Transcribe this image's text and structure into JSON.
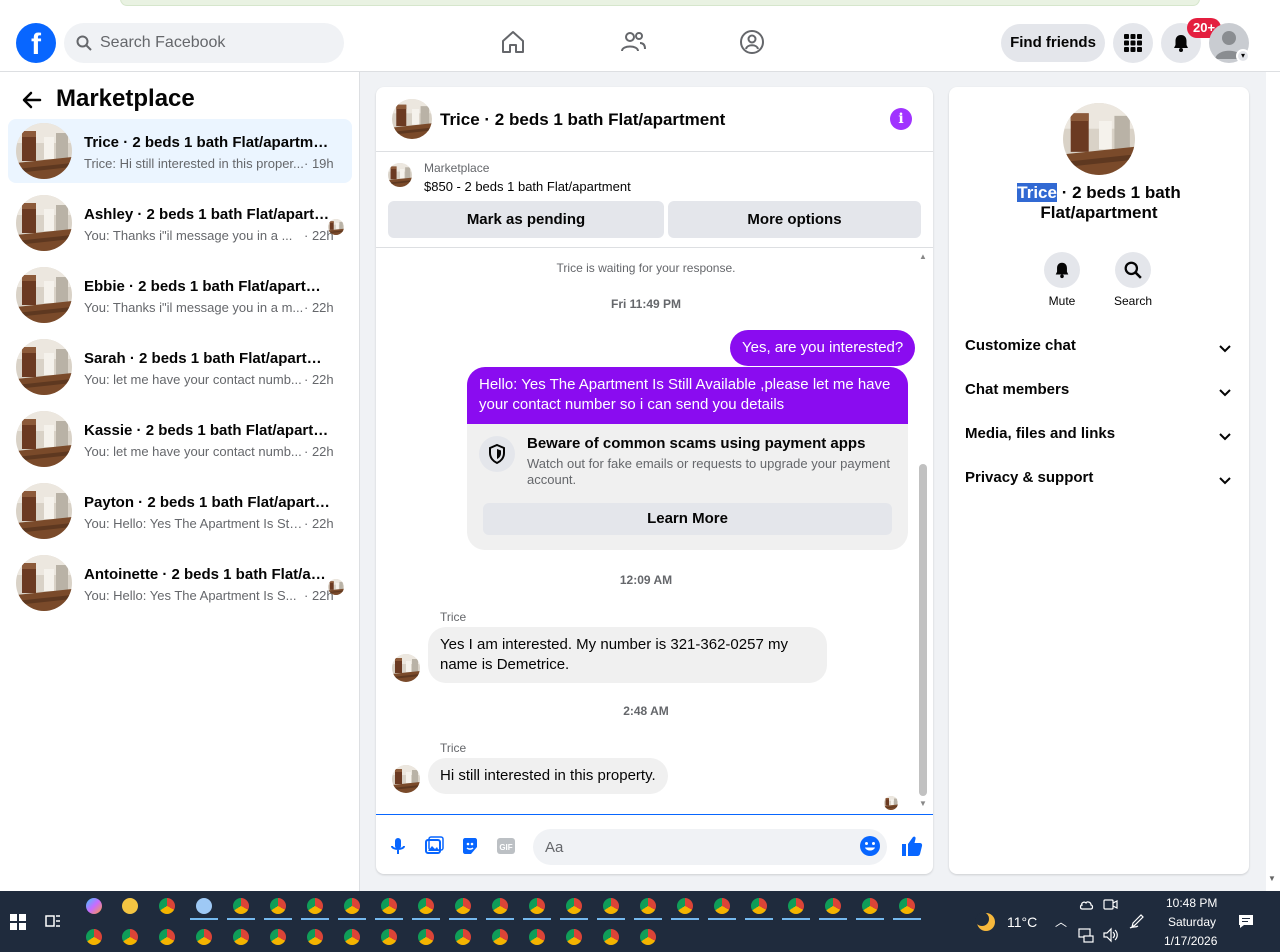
{
  "header": {
    "logo": "f",
    "search_placeholder": "Search Facebook",
    "find_friends": "Find friends",
    "notif_badge": "20+",
    "icons": [
      "home-icon",
      "friends-icon",
      "groups-icon",
      "menu-grid-icon",
      "bell-icon",
      "profile-icon"
    ],
    "accent": "#0866ff"
  },
  "sidebar": {
    "title": "Marketplace",
    "conversations": [
      {
        "title": "Trice · 2 beds 1 bath Flat/apartment",
        "snippet": "Trice: Hi still interested in this proper...",
        "time": "· 19h",
        "active": true
      },
      {
        "title": "Ashley · 2 beds 1 bath Flat/apartment",
        "snippet": "You: Thanks i\"il message you in a ...",
        "time": "· 22h"
      },
      {
        "title": "Ebbie · 2 beds 1 bath Flat/apartment",
        "snippet": "You: Thanks i\"il message you in a m...",
        "time": "· 22h"
      },
      {
        "title": "Sarah · 2 beds 1 bath Flat/apartment",
        "snippet": "You: let me have your contact numb...",
        "time": "· 22h"
      },
      {
        "title": "Kassie · 2 beds 1 bath Flat/apartment",
        "snippet": "You: let me have your contact numb...",
        "time": "· 22h"
      },
      {
        "title": "Payton · 2 beds 1 bath Flat/apartment",
        "snippet": "You: Hello: Yes The Apartment Is Still ...",
        "time": "· 22h"
      },
      {
        "title": "Antoinette · 2 beds 1 bath Flat/apartment",
        "snippet": "You: Hello: Yes The Apartment Is S...",
        "time": "· 22h"
      }
    ]
  },
  "chat": {
    "title": "Trice · 2 beds 1 bath Flat/apartment",
    "info_glyph": "i",
    "listing_label": "Marketplace",
    "listing_price": "$850 - 2 beds 1 bath Flat/apartment",
    "mark_pending": "Mark as pending",
    "more_options": "More options",
    "waiting": "Trice is waiting for your response.",
    "ts1": "Fri 11:49 PM",
    "out1": "Yes, are you interested?",
    "out2": "Hello: Yes The Apartment Is Still Available ,please let me have your contact number so i can send you details",
    "scam_title": "Beware of common scams using payment apps",
    "scam_desc": "Watch out for fake emails or requests to upgrade your payment account.",
    "learn_more": "Learn More",
    "ts2": "12:09 AM",
    "sender1": "Trice",
    "in1": "Yes I am interested. My number is 321-362-0257 my name is Demetrice.",
    "ts3": "2:48 AM",
    "sender2": "Trice",
    "in2": "Hi still interested in this property.",
    "composer_placeholder": "Aa",
    "outgoing_color": "#8a0cf0"
  },
  "details": {
    "name_highlight": "Trice",
    "name_rest": " · 2 beds 1 bath Flat/apartment",
    "mute": "Mute",
    "search": "Search",
    "sections": [
      "Customize chat",
      "Chat members",
      "Media, files and links",
      "Privacy & support"
    ]
  },
  "taskbar": {
    "weather": "11°C",
    "time": "10:48 PM",
    "day": "Saturday",
    "date": "1/17/2026"
  }
}
